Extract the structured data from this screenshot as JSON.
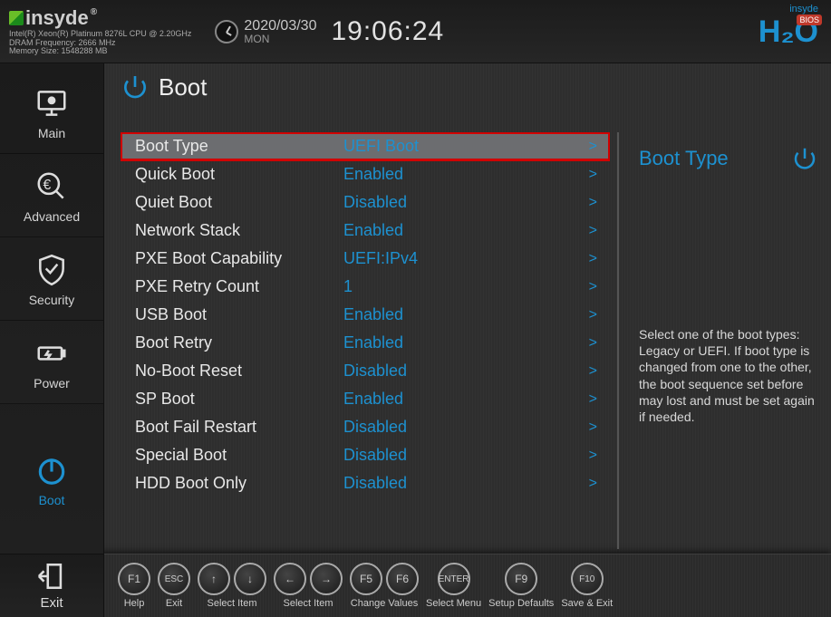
{
  "brand": {
    "name": "insyde",
    "cpu_line": "Intel(R) Xeon(R) Platinum 8276L CPU @ 2.20GHz",
    "dram_line": "DRAM Frequency: 2666 MHz",
    "mem_line": "Memory Size: 1548288 MB"
  },
  "clock": {
    "date": "2020/03/30",
    "dow": "MON",
    "time": "19:06:24"
  },
  "h2o": {
    "small": "insyde",
    "big": "H₂O",
    "bios": "BIOS"
  },
  "nav": {
    "items": [
      {
        "id": "main",
        "label": "Main"
      },
      {
        "id": "advanced",
        "label": "Advanced"
      },
      {
        "id": "security",
        "label": "Security"
      },
      {
        "id": "power",
        "label": "Power"
      },
      {
        "id": "boot",
        "label": "Boot"
      }
    ],
    "active": "boot",
    "exit": "Exit"
  },
  "page": {
    "title": "Boot",
    "settings": [
      {
        "label": "Boot Type",
        "value": "UEFI Boot",
        "selected": true
      },
      {
        "label": "Quick Boot",
        "value": "Enabled"
      },
      {
        "label": "Quiet Boot",
        "value": "Disabled"
      },
      {
        "label": "Network Stack",
        "value": "Enabled"
      },
      {
        "label": "PXE Boot Capability",
        "value": "UEFI:IPv4"
      },
      {
        "label": "PXE Retry Count",
        "value": "1"
      },
      {
        "label": "USB Boot",
        "value": "Enabled"
      },
      {
        "label": "Boot Retry",
        "value": "Enabled"
      },
      {
        "label": "No-Boot Reset",
        "value": "Disabled"
      },
      {
        "label": "SP Boot",
        "value": "Enabled"
      },
      {
        "label": "Boot Fail Restart",
        "value": "Disabled"
      },
      {
        "label": "Special Boot",
        "value": "Disabled"
      },
      {
        "label": "HDD Boot Only",
        "value": "Disabled"
      }
    ]
  },
  "help": {
    "title": "Boot Type",
    "desc": "Select one of the boot types: Legacy or UEFI. If boot type is changed from one to the other, the boot sequence set before may lost and must be set again if needed."
  },
  "footer": {
    "keys": [
      {
        "caps": [
          "F1"
        ],
        "label": "Help"
      },
      {
        "caps": [
          "ESC"
        ],
        "label": "Exit"
      },
      {
        "caps": [
          "↑",
          "↓"
        ],
        "label": "Select Item"
      },
      {
        "caps": [
          "←",
          "→"
        ],
        "label": "Select Item"
      },
      {
        "caps": [
          "F5",
          "F6"
        ],
        "label": "Change Values"
      },
      {
        "caps": [
          "ENTER"
        ],
        "label": "Select Menu"
      },
      {
        "caps": [
          "F9"
        ],
        "label": "Setup Defaults"
      },
      {
        "caps": [
          "F10"
        ],
        "label": "Save & Exit"
      }
    ]
  },
  "colors": {
    "accent": "#1d91d0",
    "highlight_border": "#d10000"
  }
}
